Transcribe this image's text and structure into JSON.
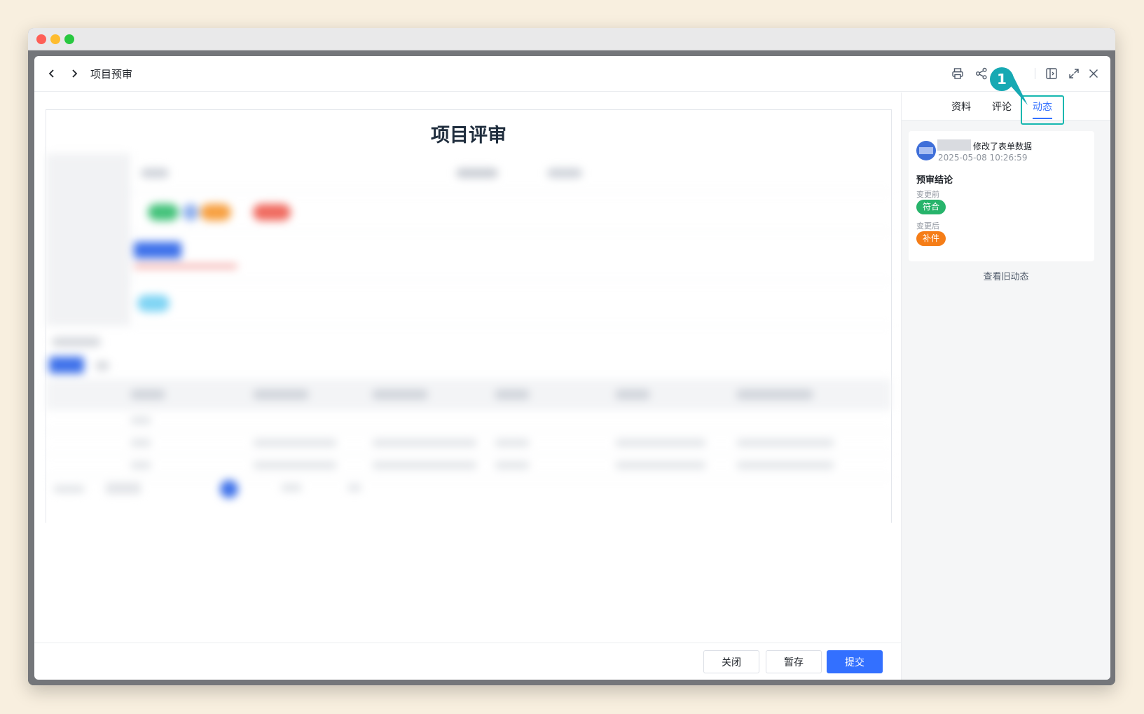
{
  "header": {
    "title": "项目预审"
  },
  "form": {
    "title": "项目评审"
  },
  "footer": {
    "close_label": "关闭",
    "save_label": "暂存",
    "submit_label": "提交"
  },
  "side_panel": {
    "tabs": [
      "资料",
      "评论",
      "动态"
    ],
    "active_tab": "动态",
    "activity": {
      "action": "修改了表单数据",
      "timestamp": "2025-05-08 10:26:59",
      "field": "预审结论",
      "before_label": "变更前",
      "before_value": "符合",
      "before_color": "#27b46b",
      "after_label": "变更后",
      "after_value": "补件",
      "after_color": "#f57d17"
    },
    "old_activity_link": "查看旧动态"
  },
  "annotation": {
    "callout_number": "1"
  },
  "colors": {
    "accent": "#3370ff",
    "callout": "#17a9b3"
  }
}
